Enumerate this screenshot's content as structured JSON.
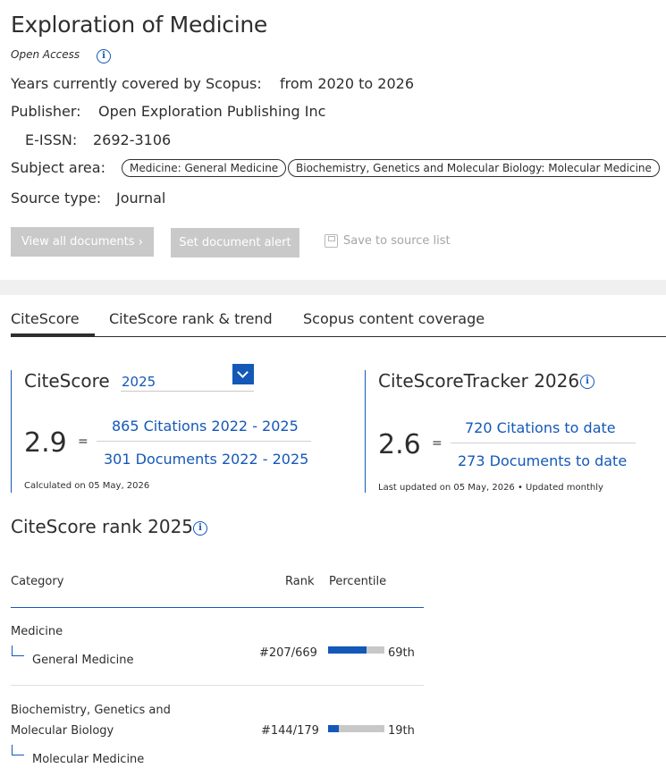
{
  "source": {
    "title": "Exploration of Medicine",
    "access": "Open Access",
    "years_label": "Years currently covered by Scopus:",
    "years_value": "from 2020 to 2026",
    "publisher_label": "Publisher:",
    "publisher_value": "Open Exploration Publishing Inc",
    "eissn_label": "E-ISSN:",
    "eissn_value": "2692-3106",
    "subject_label": "Subject area:",
    "subjects": [
      "Medicine: General Medicine",
      "Biochemistry, Genetics and Molecular Biology: Molecular Medicine"
    ],
    "source_type_label": "Source type:",
    "source_type_value": "Journal"
  },
  "actions": {
    "view_all": "View all documents",
    "set_alert": "Set document alert",
    "save": "Save to source list"
  },
  "tabs": [
    "CiteScore",
    "CiteScore rank & trend",
    "Scopus content coverage"
  ],
  "citescore": {
    "label": "CiteScore",
    "year": "2025",
    "value": "2.9",
    "equals": "=",
    "citations": "865 Citations 2022 - 2025",
    "documents": "301 Documents 2022 - 2025",
    "calculated": "Calculated on 05 May, 2026"
  },
  "tracker": {
    "label": "CiteScoreTracker 2026",
    "value": "2.6",
    "equals": "=",
    "citations": "720 Citations to date",
    "documents": "273 Documents to date",
    "updated": "Last updated on 05 May, 2026 • Updated monthly"
  },
  "rank": {
    "title": "CiteScore rank 2025",
    "headers": {
      "category": "Category",
      "rank": "Rank",
      "percentile": "Percentile"
    },
    "rows": [
      {
        "category": "Medicine",
        "subcategory": "General Medicine",
        "rank": "#207/669",
        "percentile": "69th",
        "percentile_value": 69
      },
      {
        "category_line1": "Biochemistry, Genetics and",
        "category_line2": "Molecular Biology",
        "subcategory": "Molecular Medicine",
        "rank": "#144/179",
        "percentile": "19th",
        "percentile_value": 19
      }
    ]
  },
  "colors": {
    "accent": "#1458b8",
    "text": "#2e2e2e",
    "disabled": "#c9c9c9"
  }
}
